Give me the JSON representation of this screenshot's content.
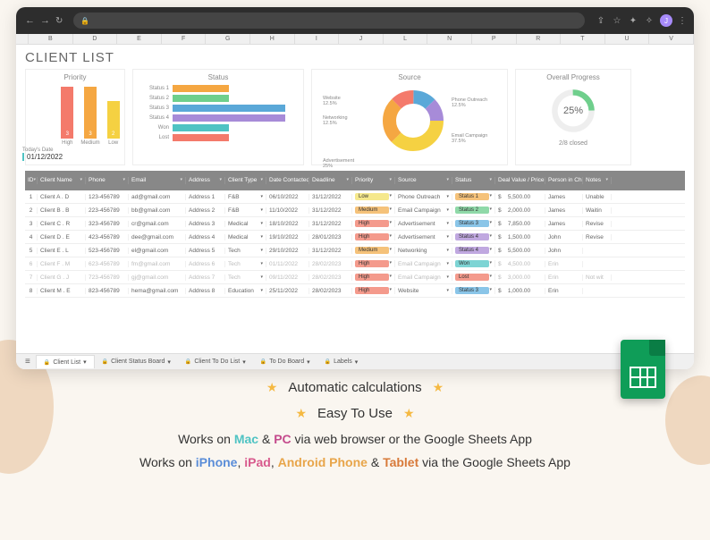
{
  "browser": {
    "avatar_initial": "J"
  },
  "title": "CLIENT LIST",
  "date": {
    "label": "Today's Date",
    "value": "01/12/2022"
  },
  "chart_data": [
    {
      "type": "bar",
      "title": "Priority",
      "categories": [
        "High",
        "Medium",
        "Low"
      ],
      "values": [
        3,
        3,
        2
      ],
      "colors": [
        "#f47a6b",
        "#f5a742",
        "#f5d142"
      ]
    },
    {
      "type": "bar",
      "orientation": "horizontal",
      "title": "Status",
      "categories": [
        "Status 1",
        "Status 2",
        "Status 3",
        "Status 4",
        "Won",
        "Lost"
      ],
      "values": [
        1,
        1,
        2,
        2,
        1,
        1
      ],
      "colors": [
        "#f5a742",
        "#6fcf8c",
        "#5aa8d8",
        "#a78bd8",
        "#4fc3c3",
        "#f47a6b"
      ]
    },
    {
      "type": "pie",
      "title": "Source",
      "series": [
        {
          "name": "Website",
          "value": 12.5,
          "color": "#5aa8d8"
        },
        {
          "name": "Phone Outreach",
          "value": 12.5,
          "color": "#a78bd8"
        },
        {
          "name": "Networking",
          "value": 12.5,
          "color": "#f47a6b"
        },
        {
          "name": "Email Campaign",
          "value": 37.5,
          "color": "#f5d142"
        },
        {
          "name": "Advertisement",
          "value": 25.0,
          "color": "#f5a742"
        }
      ]
    },
    {
      "type": "donut",
      "title": "Overall Progress",
      "value": 25,
      "label": "25%",
      "sublabel": "2/8 closed",
      "color": "#6fcf8c"
    }
  ],
  "headers": [
    "ID",
    "Client Name",
    "Phone",
    "Email",
    "Address",
    "Client Type",
    "Date Contacted",
    "Deadline",
    "Priority",
    "Source",
    "Status",
    "Deal Value / Price Value",
    "Person in Charge",
    "Notes"
  ],
  "rows": [
    {
      "id": 1,
      "name": "Client A . D",
      "phone": "123-456789",
      "email": "ad@gmail.com",
      "addr": "Address 1",
      "type": "F&B",
      "date": "06/10/2022",
      "dead": "31/12/2022",
      "prio": "Low",
      "prio_c": "#f5e88c",
      "src": "Phone Outreach",
      "status": "Status 1",
      "status_c": "#f5c27a",
      "deal": "5,500.00",
      "person": "James",
      "notes": "Unable",
      "faded": false
    },
    {
      "id": 2,
      "name": "Client B . B",
      "phone": "223-456789",
      "email": "bb@gmail.com",
      "addr": "Address 2",
      "type": "F&B",
      "date": "11/10/2022",
      "dead": "31/12/2022",
      "prio": "Medium",
      "prio_c": "#f5c27a",
      "src": "Email Campaign",
      "status": "Status 2",
      "status_c": "#8fd9a8",
      "deal": "2,000.00",
      "person": "James",
      "notes": "Waitin",
      "faded": false
    },
    {
      "id": 3,
      "name": "Client C . R",
      "phone": "323-456789",
      "email": "cr@gmail.com",
      "addr": "Address 3",
      "type": "Medical",
      "date": "18/10/2022",
      "dead": "31/12/2022",
      "prio": "High",
      "prio_c": "#f49a8c",
      "src": "Advertisement",
      "status": "Status 3",
      "status_c": "#8ac5e8",
      "deal": "7,850.00",
      "person": "James",
      "notes": "Revise",
      "faded": false
    },
    {
      "id": 4,
      "name": "Client D . E",
      "phone": "423-456789",
      "email": "dee@gmail.com",
      "addr": "Address 4",
      "type": "Medical",
      "date": "19/10/2022",
      "dead": "28/01/2023",
      "prio": "High",
      "prio_c": "#f49a8c",
      "src": "Advertisement",
      "status": "Status 4",
      "status_c": "#c0a8e0",
      "deal": "1,500.00",
      "person": "John",
      "notes": "Revise",
      "faded": false
    },
    {
      "id": 5,
      "name": "Client E . L",
      "phone": "523-456789",
      "email": "el@gmail.com",
      "addr": "Address 5",
      "type": "Tech",
      "date": "29/10/2022",
      "dead": "31/12/2022",
      "prio": "Medium",
      "prio_c": "#f5c27a",
      "src": "Networking",
      "status": "Status 4",
      "status_c": "#c0a8e0",
      "deal": "5,500.00",
      "person": "John",
      "notes": "",
      "faded": false
    },
    {
      "id": 6,
      "name": "Client F . M",
      "phone": "623-456789",
      "email": "fm@gmail.com",
      "addr": "Address 6",
      "type": "Tech",
      "date": "01/11/2022",
      "dead": "28/02/2023",
      "prio": "High",
      "prio_c": "#f49a8c",
      "src": "Email Campaign",
      "status": "Won",
      "status_c": "#7dd4d4",
      "deal": "4,500.00",
      "person": "Erin",
      "notes": "",
      "faded": true
    },
    {
      "id": 7,
      "name": "Client G . J",
      "phone": "723-456789",
      "email": "gj@gmail.com",
      "addr": "Address 7",
      "type": "Tech",
      "date": "09/11/2022",
      "dead": "28/02/2023",
      "prio": "High",
      "prio_c": "#f49a8c",
      "src": "Email Campaign",
      "status": "Lost",
      "status_c": "#f49a8c",
      "deal": "3,000.00",
      "person": "Erin",
      "notes": "Not wit",
      "faded": true
    },
    {
      "id": 8,
      "name": "Client M . E",
      "phone": "823-456789",
      "email": "hema@gmail.com",
      "addr": "Address 8",
      "type": "Education",
      "date": "25/11/2022",
      "dead": "28/02/2023",
      "prio": "High",
      "prio_c": "#f49a8c",
      "src": "Website",
      "status": "Status 3",
      "status_c": "#8ac5e8",
      "deal": "1,000.00",
      "person": "Erin",
      "notes": "",
      "faded": false
    }
  ],
  "tabs": [
    "Client List",
    "Client Status Board",
    "Client To Do List",
    "To Do Board",
    "Labels"
  ],
  "promo": {
    "line1": "Automatic calculations",
    "line2": "Easy To Use",
    "line3_parts": {
      "pre": "Works on ",
      "mac": "Mac",
      "amp": " & ",
      "pc": "PC",
      "post": " via web browser or the Google Sheets App"
    },
    "line4_parts": {
      "pre": "Works on ",
      "iphone": "iPhone",
      "c1": ", ",
      "ipad": "iPad",
      "c2": ", ",
      "android": "Android Phone",
      "amp": " & ",
      "tablet": "Tablet",
      "post": " via the Google Sheets App"
    }
  },
  "currency": "$"
}
